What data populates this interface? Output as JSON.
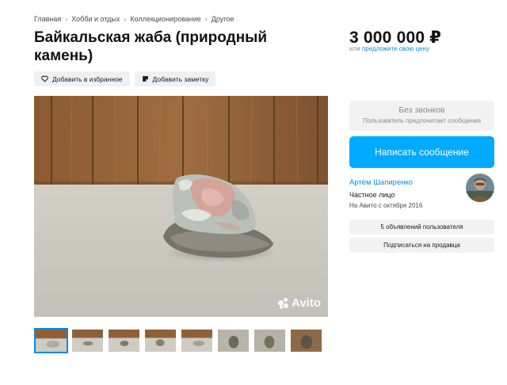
{
  "breadcrumb": [
    "Главная",
    "Хобби и отдых",
    "Коллекционирование",
    "Другое"
  ],
  "listing": {
    "title": "Байкальская жаба (природный камень)",
    "price": "3 000 000 ₽",
    "price_prefix": "или",
    "price_link": "предложите свою цену"
  },
  "actions": {
    "favorite": "Добавить в избранное",
    "note": "Добавить заметку"
  },
  "photo": {
    "watermark": "Avito",
    "thumbnail_count": 8,
    "active_thumbnail": 1
  },
  "contact": {
    "no_calls_title": "Без звонков",
    "no_calls_sub": "Пользователь предпочитает сообщения",
    "write_button": "Написать сообщение"
  },
  "seller": {
    "name": "Артём Шапиренко",
    "type": "Частное лицо",
    "since": "На Авито с октября 2016",
    "ads_button": "5 объявлений пользователя",
    "subscribe_button": "Подписаться на продавца"
  },
  "colors": {
    "accent": "#00aaff",
    "link": "#0a8be0",
    "button_bg": "#eef1f4",
    "muted": "#8a8a8a"
  },
  "icons": [
    "heart-icon",
    "note-icon",
    "chevron-right-icon",
    "avito-logo-icon"
  ]
}
